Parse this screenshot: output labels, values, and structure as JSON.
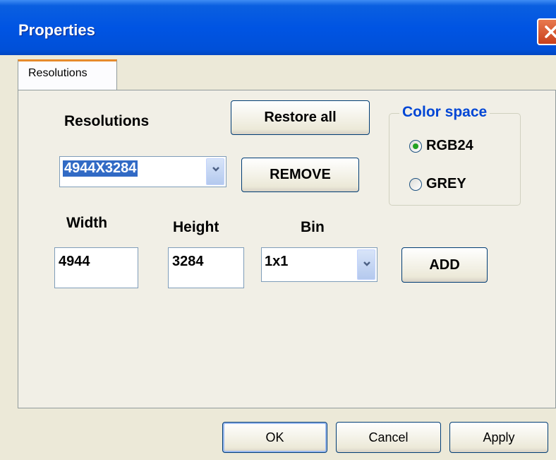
{
  "window": {
    "title": "Properties"
  },
  "tabs": [
    {
      "label": "Resolutions"
    }
  ],
  "resolutions": {
    "label": "Resolutions",
    "selected": "4944X3284",
    "restore_all_label": "Restore all",
    "remove_label": "REMOVE"
  },
  "color_space": {
    "legend": "Color space",
    "options": [
      {
        "label": "RGB24",
        "checked": true
      },
      {
        "label": "GREY",
        "checked": false
      }
    ]
  },
  "fields": {
    "width_label": "Width",
    "width_value": "4944",
    "height_label": "Height",
    "height_value": "3284",
    "bin_label": "Bin",
    "bin_value": "1x1",
    "add_label": "ADD"
  },
  "footer": {
    "ok_label": "OK",
    "cancel_label": "Cancel",
    "apply_label": "Apply"
  },
  "colors": {
    "title_bar": "#0054e3",
    "dialog_bg": "#ece9d8",
    "panel_bg": "#f1efe6",
    "legend_text": "#0046d5",
    "tab_highlight": "#e68b2c",
    "radio_checked": "#21a121"
  },
  "icons": {
    "close": "close-icon",
    "dropdown": "chevron-down-icon"
  }
}
